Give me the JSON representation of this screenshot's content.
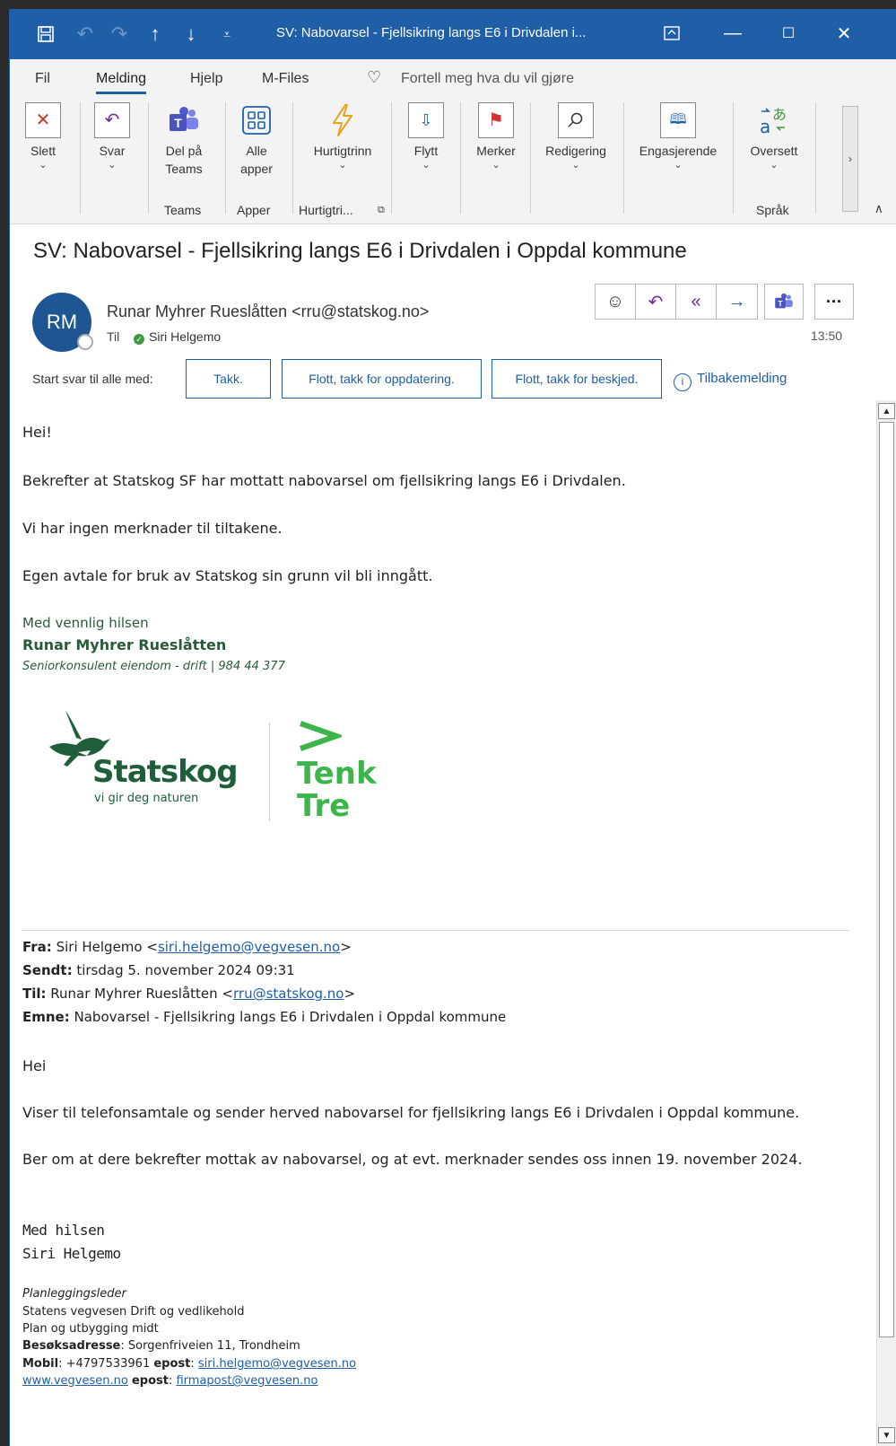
{
  "titlebar": {
    "title": "SV: Nabovarsel - Fjellsikring langs E6 i Drivdalen i..."
  },
  "menu": {
    "items": [
      "Fil",
      "Melding",
      "Hjelp",
      "M-Files"
    ],
    "tell_me": "Fortell meg hva du vil gjøre"
  },
  "ribbon": {
    "delete": "Slett",
    "reply": "Svar",
    "teams": [
      "Del på",
      "Teams"
    ],
    "apps": [
      "Alle",
      "apper"
    ],
    "quicksteps": "Hurtigtrinn",
    "move": "Flytt",
    "tags": "Merker",
    "editing": "Redigering",
    "engaging": "Engasjerende",
    "translate": "Oversett",
    "groups": {
      "teams": "Teams",
      "apps": "Apper",
      "quick": "Hurtigtri...",
      "lang": "Språk"
    }
  },
  "message": {
    "subject": "SV: Nabovarsel - Fjellsikring langs E6 i Drivdalen i Oppdal kommune",
    "avatar_initials": "RM",
    "sender": "Runar Myhrer Rueslåtten <rru@statskog.no>",
    "to_label": "Til",
    "to_name": "Siri Helgemo",
    "time": "13:50",
    "quick_reply_label": "Start svar til alle med:",
    "quick_replies": [
      "Takk.",
      "Flott, takk for oppdatering.",
      "Flott, takk for beskjed."
    ],
    "acknowledge": "Tilbakemelding"
  },
  "body": {
    "greeting": "Hei!",
    "p1": "Bekrefter at Statskog SF har mottatt nabovarsel om fjellsikring langs E6 i Drivdalen.",
    "p2": "Vi har ingen merknader til tiltakene.",
    "p3": "Egen avtale for bruk av Statskog sin grunn vil bli inngått.",
    "sig_closing": "Med vennlig hilsen",
    "sig_name": "Runar Myhrer Rueslåtten",
    "sig_title": "Seniorkonsulent eiendom - drift | 984 44 377",
    "logo_name": "Statskog",
    "logo_tagline": "vi gir deg naturen",
    "logo2_line1": "Tenk",
    "logo2_line2": "Tre"
  },
  "quoted": {
    "from_label": "Fra:",
    "from_name": "Siri Helgemo <",
    "from_email": "siri.helgemo@vegvesen.no",
    "from_end": ">",
    "sent_label": "Sendt:",
    "sent_value": "tirsdag 5. november 2024 09:31",
    "to_label": "Til:",
    "to_name": "Runar Myhrer Rueslåtten <",
    "to_email": "rru@statskog.no",
    "to_end": ">",
    "subject_label": "Emne:",
    "subject_value": "Nabovarsel - Fjellsikring langs E6 i Drivdalen i Oppdal kommune",
    "greeting": "Hei",
    "p1": "Viser til telefonsamtale og sender herved nabovarsel for fjellsikring langs E6 i Drivdalen i Oppdal kommune.",
    "p2": "Ber om at dere bekrefter mottak av nabovarsel, og at evt. merknader sendes oss innen 19. november 2024.",
    "closing": "Med hilsen",
    "name": "Siri Helgemo",
    "role": "Planleggingsleder",
    "org1": "Statens vegvesen Drift og vedlikehold",
    "org2": "Plan og utbygging midt",
    "visit_label": "Besøksadresse",
    "visit_value": ": Sorgenfriveien 11, Trondheim",
    "mobile_label": "Mobil",
    "mobile_value": ": +4797533961 ",
    "epost_label": "epost",
    "epost_value": "siri.helgemo@vegvesen.no",
    "web": "www.vegvesen.no",
    "epost2_label": "epost",
    "epost2_value": "firmapost@vegvesen.no"
  },
  "colors": {
    "titlebar": "#1e5fa8",
    "statskog_green": "#1f5e3a",
    "tenktre_green": "#3cb64a"
  }
}
